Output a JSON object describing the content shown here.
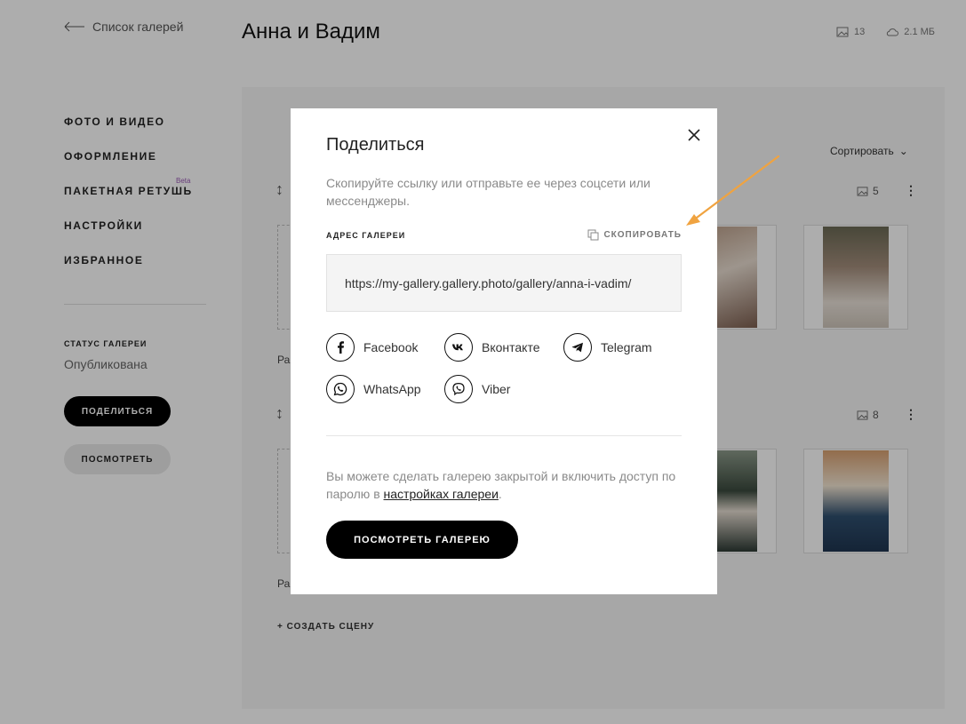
{
  "header": {
    "back_label": "Список галерей",
    "gallery_title": "Анна и Вадим",
    "photo_count": "13",
    "storage_size": "2.1 МБ"
  },
  "sidebar": {
    "items": [
      {
        "label": "ФОТО И ВИДЕО"
      },
      {
        "label": "ОФОРМЛЕНИЕ"
      },
      {
        "label": "ПАКЕТНАЯ РЕТУШЬ",
        "badge": "Beta"
      },
      {
        "label": "НАСТРОЙКИ"
      },
      {
        "label": "ИЗБРАННОЕ"
      }
    ],
    "status_label": "СТАТУС ГАЛЕРЕИ",
    "status_value": "Опубликована",
    "share_button": "ПОДЕЛИТЬСЯ",
    "view_button": "ПОСМОТРЕТЬ"
  },
  "main": {
    "sort_label": "Сортировать",
    "scenes": [
      {
        "count": "5",
        "label_fragment": "Ра"
      },
      {
        "count": "8",
        "label_fragment": "Ра"
      }
    ],
    "add_scene": "+ СОЗДАТЬ СЦЕНУ"
  },
  "modal": {
    "title": "Поделиться",
    "description": "Скопируйте ссылку или отправьте ее через соцсети или мессенджеры.",
    "address_label": "АДРЕС ГАЛЕРЕИ",
    "copy_label": "СКОПИРОВАТЬ",
    "gallery_url": "https://my-gallery.gallery.photo/gallery/anna-i-vadim/",
    "socials": [
      {
        "name": "Facebook",
        "icon": "facebook-icon"
      },
      {
        "name": "Вконтакте",
        "icon": "vk-icon"
      },
      {
        "name": "Telegram",
        "icon": "telegram-icon"
      },
      {
        "name": "WhatsApp",
        "icon": "whatsapp-icon"
      },
      {
        "name": "Viber",
        "icon": "viber-icon"
      }
    ],
    "note_prefix": "Вы можете сделать галерею закрытой и включить доступ по паролю в ",
    "note_link": "настройках галереи",
    "note_suffix": ".",
    "view_gallery_button": "ПОСМОТРЕТЬ ГАЛЕРЕЮ"
  },
  "colors": {
    "accent_arrow": "#f0a340",
    "primary_button": "#000000",
    "overlay": "rgba(0,0,0,0.32)"
  }
}
